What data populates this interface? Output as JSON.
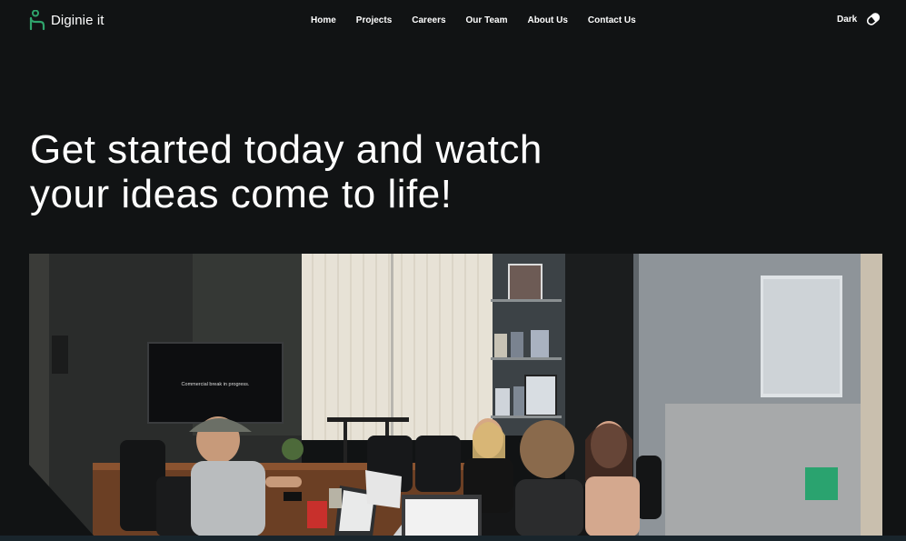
{
  "brand": {
    "name": "Diginie it",
    "logo_color": "#2fa46c"
  },
  "nav": {
    "items": [
      "Home",
      "Projects",
      "Careers",
      "Our Team",
      "About Us",
      "Contact Us"
    ]
  },
  "theme_toggle": {
    "label": "Dark",
    "icon": "moon-pill-icon"
  },
  "hero": {
    "title_line1": "Get started today and watch",
    "title_line2": "your ideas come to life!",
    "photo": {
      "description_icon": "team-meeting-photo",
      "tv_caption": "Commercial break in progress."
    }
  },
  "colors": {
    "background": "#111314",
    "accent": "#2aa36f",
    "text": "#ffffff"
  }
}
